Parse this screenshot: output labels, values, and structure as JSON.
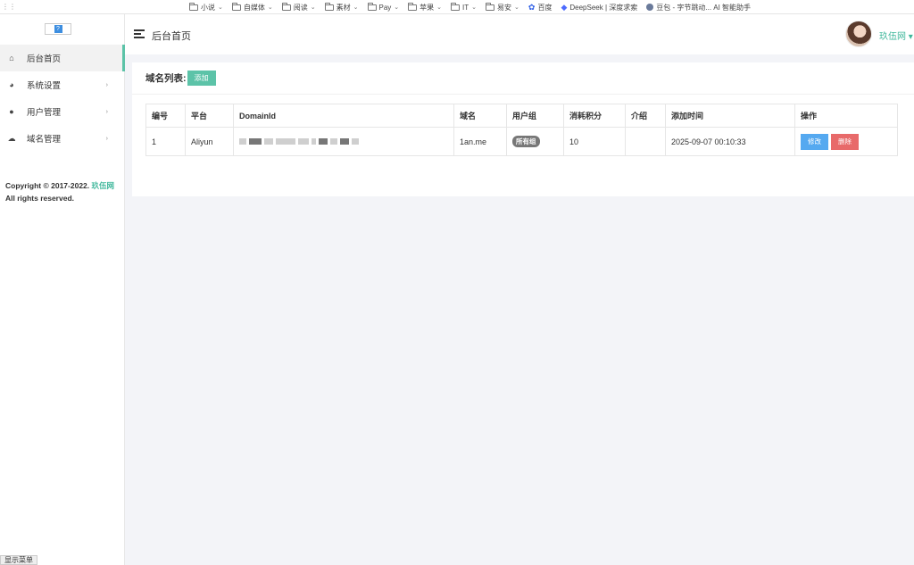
{
  "bookmarks": {
    "items": [
      {
        "label": "小说",
        "type": "folder"
      },
      {
        "label": "自媒体",
        "type": "folder"
      },
      {
        "label": "阅读",
        "type": "folder"
      },
      {
        "label": "素材",
        "type": "folder"
      },
      {
        "label": "Pay",
        "type": "folder"
      },
      {
        "label": "苹果",
        "type": "folder"
      },
      {
        "label": "IT",
        "type": "folder"
      },
      {
        "label": "易安",
        "type": "folder"
      },
      {
        "label": "百度",
        "type": "link"
      },
      {
        "label": "DeepSeek | 深度求索",
        "type": "link"
      },
      {
        "label": "豆包 - 字节跳动... AI 智能助手",
        "type": "link"
      }
    ]
  },
  "sidebar": {
    "items": [
      {
        "label": "后台首页",
        "icon": "home-icon",
        "active": true
      },
      {
        "label": "系统设置",
        "icon": "palette-icon"
      },
      {
        "label": "用户管理",
        "icon": "user-icon"
      },
      {
        "label": "域名管理",
        "icon": "cloud-icon"
      }
    ],
    "copyright_prefix": "Copyright © 2017-2022.",
    "copyright_link": "玖伍网",
    "copyright_suffix": "All rights reserved.",
    "show_menu": "显示菜单"
  },
  "header": {
    "title": "后台首页",
    "username": "玖伍网 ▾"
  },
  "main": {
    "title": "域名列表:",
    "add_label": "添加",
    "table": {
      "columns": [
        "编号",
        "平台",
        "DomainId",
        "域名",
        "用户组",
        "消耗积分",
        "介绍",
        "添加时间",
        "操作"
      ],
      "rows": [
        {
          "id": "1",
          "platform": "Aliyun",
          "domain": "1an.me",
          "group": "所有组",
          "points": "10",
          "intro": "",
          "time": "2025-09-07 00:10:33",
          "edit": "修改",
          "delete": "删除"
        }
      ]
    }
  },
  "colors": {
    "accent": "#5cc3a8",
    "edit": "#55a9f0",
    "delete": "#e86a6a"
  }
}
